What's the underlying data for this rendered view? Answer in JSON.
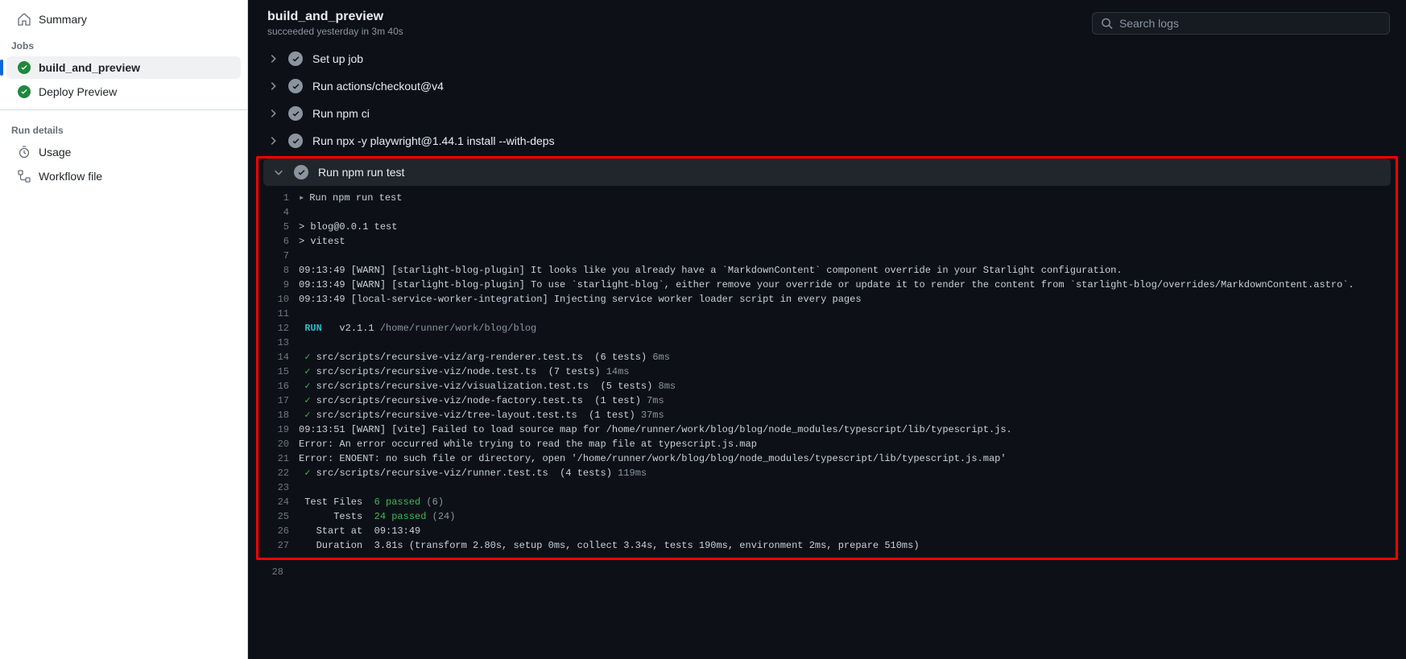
{
  "sidebar": {
    "summary_label": "Summary",
    "jobs_heading": "Jobs",
    "jobs": [
      {
        "label": "build_and_preview",
        "active": true
      },
      {
        "label": "Deploy Preview",
        "active": false
      }
    ],
    "run_details_heading": "Run details",
    "usage_label": "Usage",
    "workflow_file_label": "Workflow file"
  },
  "header": {
    "title": "build_and_preview",
    "subtitle": "succeeded yesterday in 3m 40s",
    "search_placeholder": "Search logs"
  },
  "steps": [
    {
      "label": "Set up job",
      "expanded": false
    },
    {
      "label": "Run actions/checkout@v4",
      "expanded": false
    },
    {
      "label": "Run npm ci",
      "expanded": false
    },
    {
      "label": "Run npx -y playwright@1.44.1 install --with-deps",
      "expanded": false
    },
    {
      "label": "Run npm run test",
      "expanded": true
    }
  ],
  "log": {
    "summary_line": "Run npm run test",
    "lines": [
      {
        "n": 1,
        "raw": "__DETAILS__"
      },
      {
        "n": 4,
        "raw": ""
      },
      {
        "n": 5,
        "raw": "> blog@0.0.1 test"
      },
      {
        "n": 6,
        "raw": "> vitest"
      },
      {
        "n": 7,
        "raw": ""
      },
      {
        "n": 8,
        "raw": "09:13:49 [WARN] [starlight-blog-plugin] It looks like you already have a `MarkdownContent` component override in your Starlight configuration."
      },
      {
        "n": 9,
        "raw": "09:13:49 [WARN] [starlight-blog-plugin] To use `starlight-blog`, either remove your override or update it to render the content from `starlight-blog/overrides/MarkdownContent.astro`."
      },
      {
        "n": 10,
        "raw": "09:13:49 [local-service-worker-integration] Injecting service worker loader script in every pages"
      },
      {
        "n": 11,
        "raw": ""
      },
      {
        "n": 12,
        "segments": [
          {
            "t": " RUN ",
            "cls": "c-cyan"
          },
          {
            "t": "  v2.1.1 ",
            "cls": ""
          },
          {
            "t": "/home/runner/work/blog/blog",
            "cls": "c-dim"
          }
        ]
      },
      {
        "n": 13,
        "raw": ""
      },
      {
        "n": 14,
        "segments": [
          {
            "t": " ✓ ",
            "cls": "c-tick"
          },
          {
            "t": "src/scripts/recursive-viz/arg-renderer.test.ts  (6 tests) ",
            "cls": ""
          },
          {
            "t": "6ms",
            "cls": "c-dim"
          }
        ]
      },
      {
        "n": 15,
        "segments": [
          {
            "t": " ✓ ",
            "cls": "c-tick"
          },
          {
            "t": "src/scripts/recursive-viz/node.test.ts  (7 tests) ",
            "cls": ""
          },
          {
            "t": "14ms",
            "cls": "c-dim"
          }
        ]
      },
      {
        "n": 16,
        "segments": [
          {
            "t": " ✓ ",
            "cls": "c-tick"
          },
          {
            "t": "src/scripts/recursive-viz/visualization.test.ts  (5 tests) ",
            "cls": ""
          },
          {
            "t": "8ms",
            "cls": "c-dim"
          }
        ]
      },
      {
        "n": 17,
        "segments": [
          {
            "t": " ✓ ",
            "cls": "c-tick"
          },
          {
            "t": "src/scripts/recursive-viz/node-factory.test.ts  (1 test) ",
            "cls": ""
          },
          {
            "t": "7ms",
            "cls": "c-dim"
          }
        ]
      },
      {
        "n": 18,
        "segments": [
          {
            "t": " ✓ ",
            "cls": "c-tick"
          },
          {
            "t": "src/scripts/recursive-viz/tree-layout.test.ts  (1 test) ",
            "cls": ""
          },
          {
            "t": "37ms",
            "cls": "c-dim"
          }
        ]
      },
      {
        "n": 19,
        "raw": "09:13:51 [WARN] [vite] Failed to load source map for /home/runner/work/blog/blog/node_modules/typescript/lib/typescript.js."
      },
      {
        "n": 20,
        "raw": "Error: An error occurred while trying to read the map file at typescript.js.map"
      },
      {
        "n": 21,
        "raw": "Error: ENOENT: no such file or directory, open '/home/runner/work/blog/blog/node_modules/typescript/lib/typescript.js.map'"
      },
      {
        "n": 22,
        "segments": [
          {
            "t": " ✓ ",
            "cls": "c-tick"
          },
          {
            "t": "src/scripts/recursive-viz/runner.test.ts  (4 tests) ",
            "cls": ""
          },
          {
            "t": "119ms",
            "cls": "c-dim"
          }
        ]
      },
      {
        "n": 23,
        "raw": ""
      },
      {
        "n": 24,
        "segments": [
          {
            "t": " Test Files  ",
            "cls": ""
          },
          {
            "t": "6 passed",
            "cls": "c-green"
          },
          {
            "t": " (6)",
            "cls": "c-dim"
          }
        ]
      },
      {
        "n": 25,
        "segments": [
          {
            "t": "      Tests  ",
            "cls": ""
          },
          {
            "t": "24 passed",
            "cls": "c-green"
          },
          {
            "t": " (24)",
            "cls": "c-dim"
          }
        ]
      },
      {
        "n": 26,
        "raw": "   Start at  09:13:49"
      },
      {
        "n": 27,
        "raw": "   Duration  3.81s (transform 2.80s, setup 0ms, collect 3.34s, tests 190ms, environment 2ms, prepare 510ms)"
      },
      {
        "n": 28,
        "raw": ""
      }
    ]
  },
  "highlight": {
    "line_cutoff_after": 27
  }
}
